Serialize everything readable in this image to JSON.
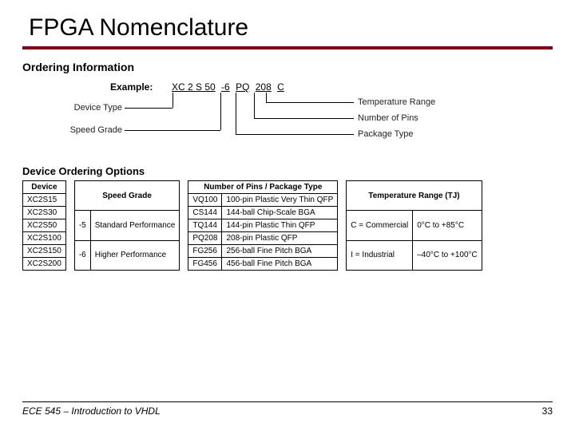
{
  "title": "FPGA Nomenclature",
  "section1": "Ordering Information",
  "example_label": "Example:",
  "pn": {
    "seg0": "XC 2 S 50",
    "seg1": "-6",
    "seg2": "PQ",
    "seg3": "208",
    "seg4": "C"
  },
  "left_calls": {
    "device_type": "Device Type",
    "speed_grade": "Speed Grade"
  },
  "right_calls": {
    "temp": "Temperature Range",
    "pins": "Number of Pins",
    "pkg": "Package Type"
  },
  "section2": "Device Ordering Options",
  "headers": {
    "device": "Device",
    "speed": "Speed Grade",
    "pkg": "Number of Pins / Package Type",
    "temp": "Temperature Range (TJ)"
  },
  "device_rows": [
    "XC2S15",
    "XC2S30",
    "XC2S50",
    "XC2S100",
    "XC2S150",
    "XC2S200"
  ],
  "speed_rows": [
    {
      "c": "-5",
      "d": "Standard Performance"
    },
    {
      "c": "-6",
      "d": "Higher Performance"
    }
  ],
  "pkg_rows": [
    {
      "c": "VQ100",
      "d": "100-pin Plastic Very Thin QFP"
    },
    {
      "c": "CS144",
      "d": "144-ball Chip-Scale BGA"
    },
    {
      "c": "TQ144",
      "d": "144-pin Plastic Thin QFP"
    },
    {
      "c": "PQ208",
      "d": "208-pin Plastic QFP"
    },
    {
      "c": "FG256",
      "d": "256-ball Fine Pitch BGA"
    },
    {
      "c": "FG456",
      "d": "456-ball Fine Pitch BGA"
    }
  ],
  "temp_rows": [
    {
      "c": "C = Commercial",
      "d": "0°C to +85°C"
    },
    {
      "c": "I = Industrial",
      "d": "–40°C to +100°C"
    }
  ],
  "footer_left": "ECE 545 – Introduction to VHDL",
  "footer_page": "33"
}
